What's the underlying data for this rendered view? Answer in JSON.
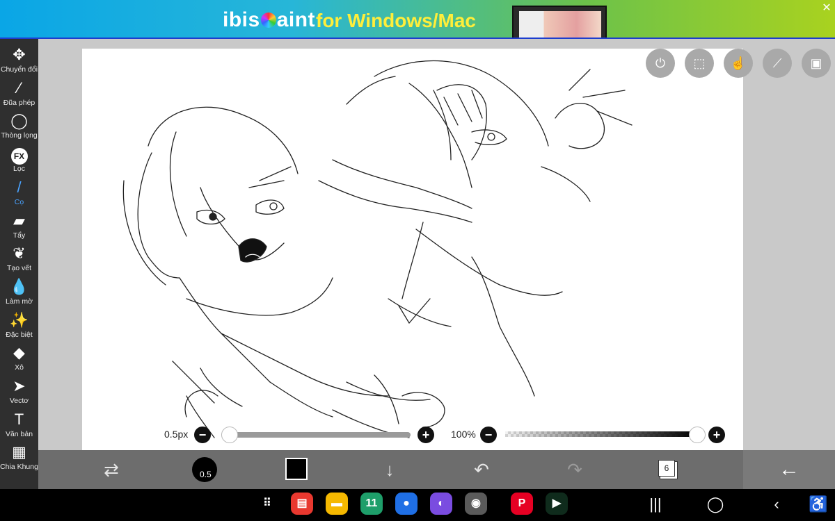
{
  "banner": {
    "logo_text_pre": "ibis",
    "logo_text_post": "aint",
    "tagline": "for Windows/Mac",
    "close_glyph": "✕"
  },
  "toolbar": {
    "items": [
      {
        "label": "Chuyển đổi",
        "icon": "move-arrows-icon",
        "glyph": "✥"
      },
      {
        "label": "Đũa phép",
        "icon": "magic-wand-icon",
        "glyph": "⁄"
      },
      {
        "label": "Thòng lọng",
        "icon": "lasso-icon",
        "glyph": "◯"
      },
      {
        "label": "Lọc",
        "icon": "fx-filter-icon",
        "glyph": "FX"
      },
      {
        "label": "Cọ",
        "icon": "brush-icon",
        "glyph": "/",
        "active": true
      },
      {
        "label": "Tẩy",
        "icon": "eraser-icon",
        "glyph": "▰"
      },
      {
        "label": "Tạo vết",
        "icon": "smudge-icon",
        "glyph": "❦"
      },
      {
        "label": "Làm mờ",
        "icon": "blur-drop-icon",
        "glyph": "💧"
      },
      {
        "label": "Đặc biệt",
        "icon": "special-sparkle-icon",
        "glyph": "✨"
      },
      {
        "label": "Xô",
        "icon": "bucket-icon",
        "glyph": "◆"
      },
      {
        "label": "Vectơ",
        "icon": "vector-cursor-icon",
        "glyph": "➤"
      },
      {
        "label": "Văn bản",
        "icon": "text-icon",
        "glyph": "T"
      },
      {
        "label": "Chia Khung",
        "icon": "frame-divider-icon",
        "glyph": "▦"
      }
    ]
  },
  "floating": [
    {
      "name": "toggle-icon",
      "glyph": "⏻"
    },
    {
      "name": "selection-icon",
      "glyph": "⬚"
    },
    {
      "name": "touch-hand-icon",
      "glyph": "☝"
    },
    {
      "name": "ruler-icon",
      "glyph": "⟋"
    },
    {
      "name": "reference-image-icon",
      "glyph": "▣"
    }
  ],
  "brush_size": {
    "label": "0.5px",
    "value": 0.5,
    "fraction": 0.0
  },
  "opacity": {
    "label": "100%",
    "value": 100,
    "fraction": 1.0
  },
  "bottom": {
    "brush_size_short": "0.5",
    "layer_count": "6",
    "swap_glyph": "⇄",
    "download_glyph": "↓",
    "undo_glyph": "↶",
    "redo_glyph": "↷",
    "back_glyph": "←",
    "color": "#000000"
  },
  "taskbar": {
    "apps": [
      {
        "name": "app-grid-icon",
        "glyph": "⠿",
        "bg": "#000000"
      },
      {
        "name": "notes-app-icon",
        "glyph": "▤",
        "bg": "#e8382f"
      },
      {
        "name": "files-app-icon",
        "glyph": "▬",
        "bg": "#f5b800"
      },
      {
        "name": "calendar-app-icon",
        "glyph": "11",
        "bg": "#1e9e6a"
      },
      {
        "name": "messages-app-icon",
        "glyph": "●",
        "bg": "#1f6fe5"
      },
      {
        "name": "browser-app-icon",
        "glyph": "◐",
        "bg": "#7a4ce0"
      },
      {
        "name": "camera-app-icon",
        "glyph": "◉",
        "bg": "#5a5a5a"
      },
      {
        "name": "pinterest-app-icon",
        "glyph": "P",
        "bg": "#e60023"
      },
      {
        "name": "video-app-icon",
        "glyph": "▶",
        "bg": "#0f2b1c"
      }
    ],
    "nav_recent": "|||",
    "nav_home": "◯",
    "nav_back": "‹",
    "nav_access": "♿"
  }
}
